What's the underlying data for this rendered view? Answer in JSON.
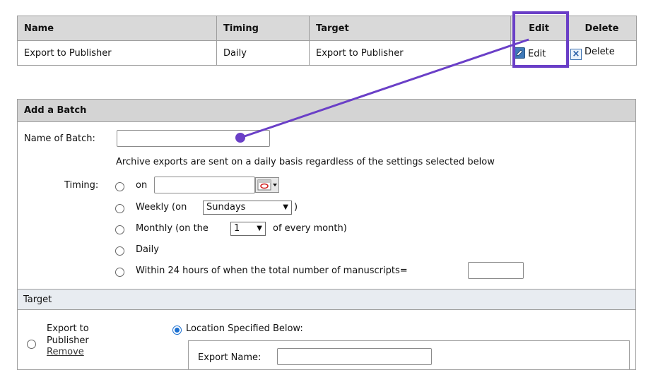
{
  "table": {
    "headers": {
      "name": "Name",
      "timing": "Timing",
      "target": "Target",
      "edit": "Edit",
      "delete": "Delete"
    },
    "rows": [
      {
        "name": "Export to Publisher",
        "timing": "Daily",
        "target": "Export to Publisher",
        "edit": "Edit",
        "delete": "Delete"
      }
    ]
  },
  "add_batch": {
    "title": "Add a Batch",
    "name_label": "Name of Batch:",
    "name_value": "",
    "archive_note": "Archive exports are sent on a daily basis regardless of the settings selected below",
    "timing_label": "Timing:",
    "on_label": "on",
    "on_value": "",
    "weekly_label": "Weekly (on",
    "weekly_close": ")",
    "weekly_selected": "Sundays",
    "monthly_label": "Monthly (on the",
    "monthly_selected": "1",
    "monthly_suffix": "of every month)",
    "daily_label": "Daily",
    "within_label": "Within 24 hours of when the total number of manuscripts=",
    "within_value": ""
  },
  "target": {
    "title": "Target",
    "export_label": "Export to Publisher",
    "remove_link": "Remove",
    "location_label": "Location Specified Below:",
    "export_name_label": "Export Name:",
    "export_name_value": ""
  },
  "annotation": {
    "color": "#6a3fc7"
  }
}
